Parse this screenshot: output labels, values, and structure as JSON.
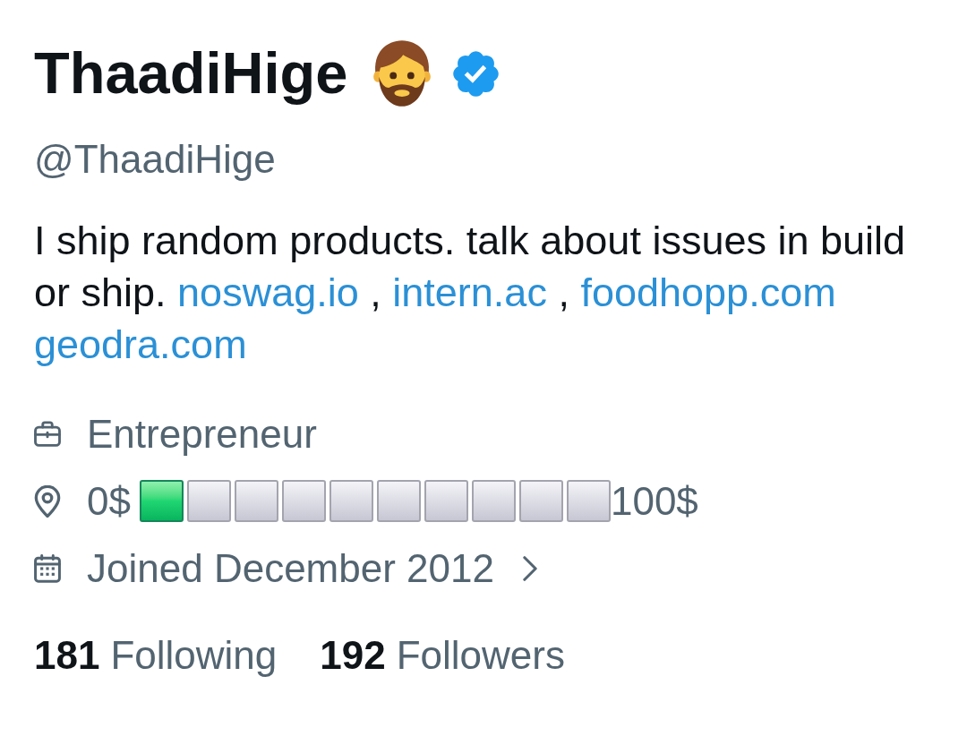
{
  "profile": {
    "name": "ThaadiHige",
    "verified": true,
    "handle": "@ThaadiHige"
  },
  "bio": [
    {
      "kind": "text",
      "text": "I ship random products. talk about issues in build or ship."
    },
    {
      "kind": "link",
      "text": "noswag.io"
    },
    {
      "kind": "text",
      "text": ","
    },
    {
      "kind": "link",
      "text": "intern.ac"
    },
    {
      "kind": "text",
      "text": ","
    },
    {
      "kind": "link",
      "text": "foodhopp.com"
    },
    {
      "kind": "link",
      "text": "geodra.com"
    }
  ],
  "details": [
    {
      "kind": "category",
      "text": "Entrepreneur"
    },
    {
      "kind": "location",
      "start": "0$",
      "squares": [
        {
          "filled": true
        },
        {
          "filled": false
        },
        {
          "filled": false
        },
        {
          "filled": false
        },
        {
          "filled": false
        },
        {
          "filled": false
        },
        {
          "filled": false
        },
        {
          "filled": false
        },
        {
          "filled": false
        },
        {
          "filled": false
        }
      ],
      "end": "100$"
    },
    {
      "kind": "joined",
      "text": "Joined December 2012"
    }
  ],
  "stats": [
    {
      "count": "181",
      "label": "Following"
    },
    {
      "count": "192",
      "label": "Followers"
    }
  ]
}
